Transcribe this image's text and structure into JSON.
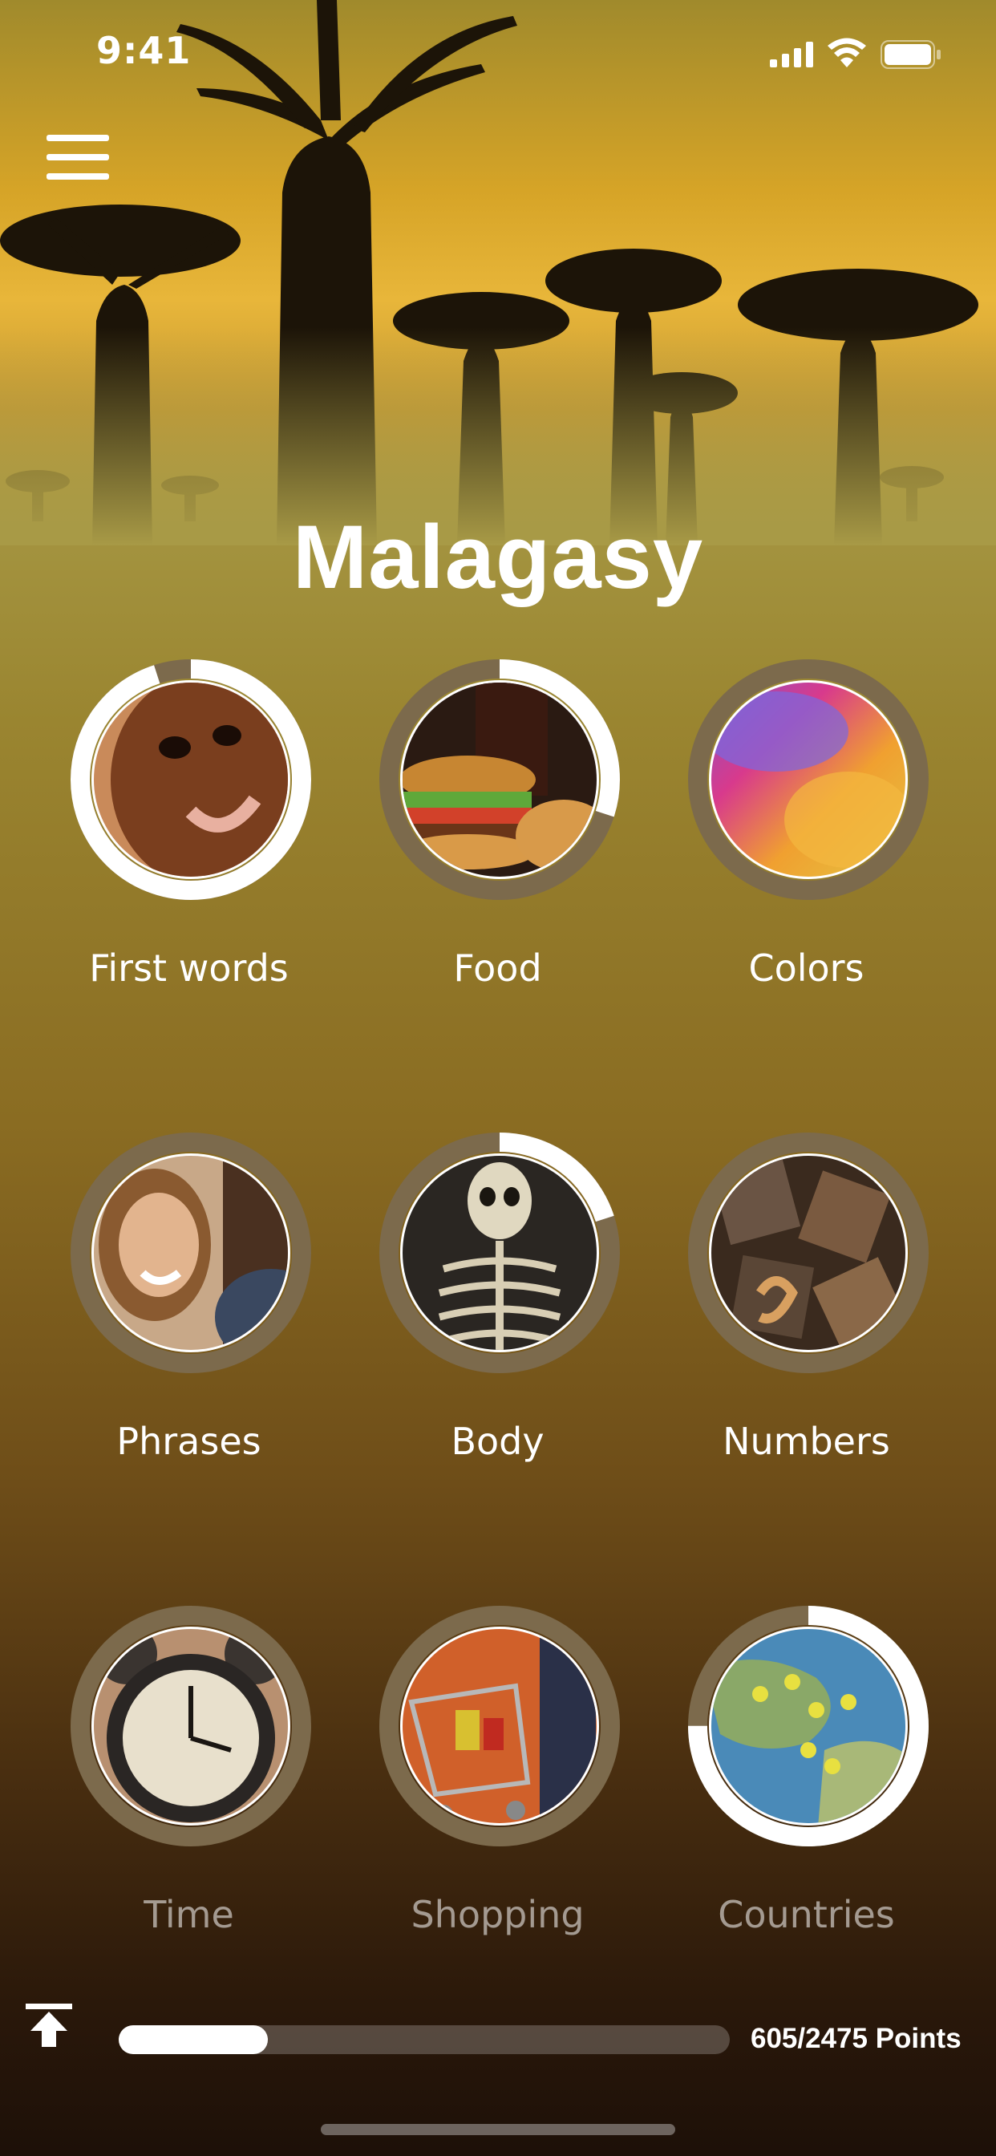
{
  "status_bar": {
    "time": "9:41"
  },
  "header": {
    "title": "Malagasy"
  },
  "categories": [
    {
      "label": "First words",
      "progress": 0.95,
      "image": "child-face"
    },
    {
      "label": "Food",
      "progress": 0.3,
      "image": "burger-and-drink"
    },
    {
      "label": "Colors",
      "progress": 0.0,
      "image": "color-powder"
    },
    {
      "label": "Phrases",
      "progress": 0.0,
      "image": "smiling-woman"
    },
    {
      "label": "Body",
      "progress": 0.2,
      "image": "skeleton"
    },
    {
      "label": "Numbers",
      "progress": 0.0,
      "image": "wooden-numbers"
    },
    {
      "label": "Time",
      "progress": 0.0,
      "image": "alarm-clock"
    },
    {
      "label": "Shopping",
      "progress": 0.0,
      "image": "shopping-cart"
    },
    {
      "label": "Countries",
      "progress": 0.75,
      "image": "world-map-pins"
    }
  ],
  "footer": {
    "points_text": "605/2475 Points",
    "progress": 0.244
  },
  "colors": {
    "ring_track": "#7c6a4c",
    "ring_progress": "#ffffff"
  }
}
